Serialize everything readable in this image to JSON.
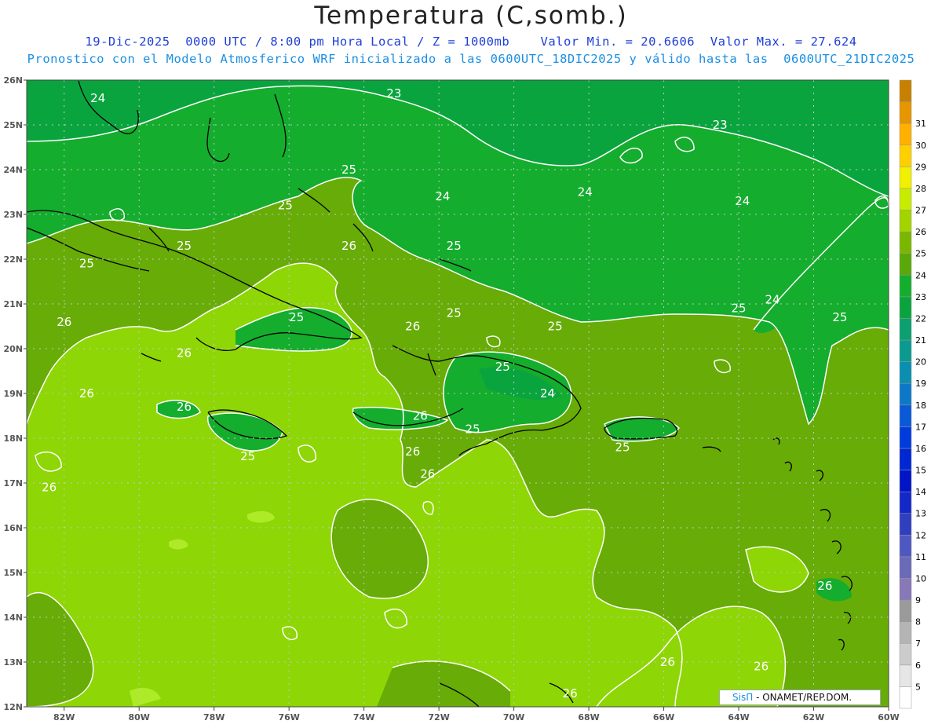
{
  "title": "Temperatura (C,somb.)",
  "subtitle_line1": "19-Dic-2025  0000 UTC / 8:00 pm Hora Local / Z = 1000mb    Valor Min. = 20.6606  Valor Max. = 27.624",
  "subtitle_line2": "Pronostico con el Modelo Atmosferico WRF inicializado a las 0600UTC_18DIC2025 y válido hasta las  0600UTC_21DIC2025",
  "credit": {
    "brand": "SisΠ",
    "text": "- ONAMET/REP.DOM."
  },
  "colors": {
    "map_23": "#0aa43e",
    "map_24": "#14ad2d",
    "map_25": "#67ac07",
    "map_26": "#8ed606",
    "map_27": "#adea28",
    "contour": "#ffffff",
    "coast": "#000000",
    "grid": "#c8c8c8"
  },
  "chart_data": {
    "type": "heatmap",
    "title": "Temperatura (C,somb.)",
    "variable": "Temperatura",
    "units": "C",
    "level": "Z = 1000mb",
    "valid": "19-Dic-2025 0000 UTC / 8:00 pm Hora Local",
    "value_min": 20.6606,
    "value_max": 27.624,
    "lon_range": [
      -83,
      -60
    ],
    "lat_range": [
      12,
      26
    ],
    "x_ticks": [
      "82W",
      "80W",
      "78W",
      "76W",
      "74W",
      "72W",
      "70W",
      "68W",
      "66W",
      "64W",
      "62W",
      "60W"
    ],
    "y_ticks": [
      "26N",
      "25N",
      "24N",
      "23N",
      "22N",
      "21N",
      "20N",
      "19N",
      "18N",
      "17N",
      "16N",
      "15N",
      "14N",
      "13N",
      "12N"
    ],
    "colorbar": {
      "levels": [
        5,
        6,
        7,
        8,
        9,
        10,
        11,
        12,
        13,
        14,
        15,
        16,
        17,
        18,
        19,
        20,
        21,
        22,
        23,
        24,
        25,
        26,
        27,
        28,
        29,
        30,
        31
      ],
      "colors": [
        "#ffffff",
        "#e6e6e6",
        "#cccccc",
        "#b4b4b4",
        "#9a9a9a",
        "#8878b8",
        "#6a6ab8",
        "#4f58c0",
        "#2f3fc0",
        "#1428c8",
        "#0014c8",
        "#0028d2",
        "#003cdc",
        "#0a5ad8",
        "#0e78c8",
        "#0a8fb0",
        "#0a9a90",
        "#0aa070",
        "#0aa43e",
        "#14ad2d",
        "#5aa80a",
        "#7ab800",
        "#a2d400",
        "#c8ec00",
        "#f0f000",
        "#ffd000",
        "#ffb000",
        "#e69600",
        "#c88000"
      ]
    },
    "contour_labels": [
      {
        "text": "24",
        "lon": -81.1,
        "lat": 25.6
      },
      {
        "text": "23",
        "lon": -73.2,
        "lat": 25.7
      },
      {
        "text": "23",
        "lon": -64.5,
        "lat": 25.0
      },
      {
        "text": "25",
        "lon": -74.4,
        "lat": 24.0
      },
      {
        "text": "24",
        "lon": -71.9,
        "lat": 23.4
      },
      {
        "text": "24",
        "lon": -68.1,
        "lat": 23.5
      },
      {
        "text": "24",
        "lon": -63.9,
        "lat": 23.3
      },
      {
        "text": "25",
        "lon": -76.1,
        "lat": 23.2
      },
      {
        "text": "25",
        "lon": -78.8,
        "lat": 22.3
      },
      {
        "text": "26",
        "lon": -74.4,
        "lat": 22.3
      },
      {
        "text": "25",
        "lon": -71.6,
        "lat": 22.3
      },
      {
        "text": "25",
        "lon": -81.4,
        "lat": 21.9
      },
      {
        "text": "25",
        "lon": -71.6,
        "lat": 20.8
      },
      {
        "text": "25",
        "lon": -64.0,
        "lat": 20.9
      },
      {
        "text": "24",
        "lon": -63.1,
        "lat": 21.1
      },
      {
        "text": "25",
        "lon": -61.3,
        "lat": 20.7
      },
      {
        "text": "25",
        "lon": -68.9,
        "lat": 20.5
      },
      {
        "text": "26",
        "lon": -82.0,
        "lat": 20.6
      },
      {
        "text": "25",
        "lon": -75.8,
        "lat": 20.7
      },
      {
        "text": "26",
        "lon": -72.7,
        "lat": 20.5
      },
      {
        "text": "26",
        "lon": -78.8,
        "lat": 19.9
      },
      {
        "text": "26",
        "lon": -81.4,
        "lat": 19.0
      },
      {
        "text": "25",
        "lon": -70.3,
        "lat": 19.6
      },
      {
        "text": "24",
        "lon": -69.1,
        "lat": 19.0
      },
      {
        "text": "26",
        "lon": -78.8,
        "lat": 18.7
      },
      {
        "text": "26",
        "lon": -72.5,
        "lat": 18.5
      },
      {
        "text": "25",
        "lon": -71.1,
        "lat": 18.2
      },
      {
        "text": "25",
        "lon": -67.1,
        "lat": 17.8
      },
      {
        "text": "26",
        "lon": -72.7,
        "lat": 17.7
      },
      {
        "text": "25",
        "lon": -77.1,
        "lat": 17.6
      },
      {
        "text": "26",
        "lon": -72.3,
        "lat": 17.2
      },
      {
        "text": "26",
        "lon": -82.4,
        "lat": 16.9
      },
      {
        "text": "26",
        "lon": -61.7,
        "lat": 14.7
      },
      {
        "text": "26",
        "lon": -65.9,
        "lat": 13.0
      },
      {
        "text": "26",
        "lon": -63.4,
        "lat": 12.9
      },
      {
        "text": "26",
        "lon": -68.5,
        "lat": 12.3
      }
    ]
  }
}
